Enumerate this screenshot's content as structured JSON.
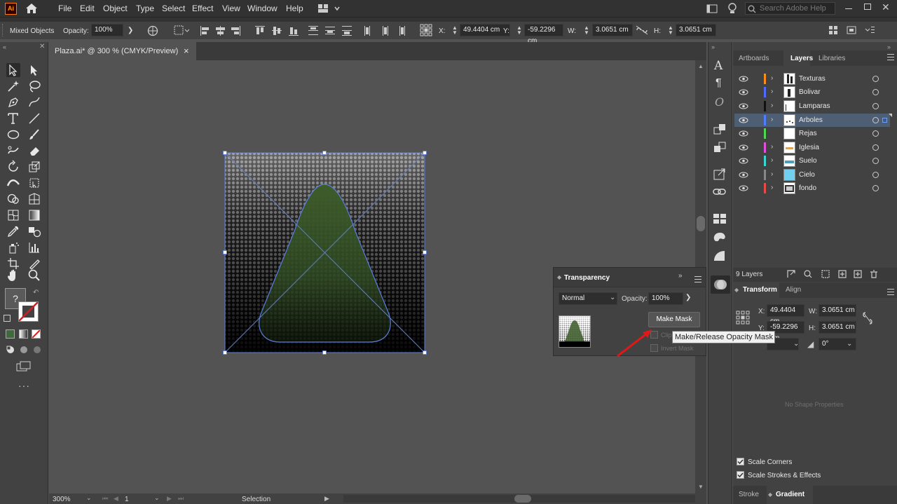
{
  "app": {
    "logo": "Ai"
  },
  "menu": [
    "File",
    "Edit",
    "Object",
    "Type",
    "Select",
    "Effect",
    "View",
    "Window",
    "Help"
  ],
  "search": {
    "placeholder": "Search Adobe Help"
  },
  "control": {
    "selection_label": "Mixed Objects",
    "opacity_label": "Opacity:",
    "opacity_value": "100%",
    "x_label": "X:",
    "x_value": "49.4404 cm",
    "y_label": "Y:",
    "y_value": "-59.2296 cm",
    "w_label": "W:",
    "w_value": "3.0651 cm",
    "h_label": "H:",
    "h_value": "3.0651 cm"
  },
  "document": {
    "tab_title": "Plaza.ai* @ 300 % (CMYK/Preview)",
    "close": "×"
  },
  "status": {
    "zoom": "300%",
    "artboard": "1",
    "tool": "Selection"
  },
  "panels": {
    "tabs": [
      "Artboards",
      "Layers",
      "Libraries"
    ],
    "layers": [
      {
        "name": "Texturas",
        "color": "#ff8c1a"
      },
      {
        "name": "Bolivar",
        "color": "#4f6cff"
      },
      {
        "name": "Lamparas",
        "color": "#111111"
      },
      {
        "name": "Arboles",
        "color": "#4f7fff",
        "selected": true
      },
      {
        "name": "Rejas",
        "color": "#4fd94f"
      },
      {
        "name": "Iglesia",
        "color": "#e44fe0"
      },
      {
        "name": "Suelo",
        "color": "#3fd4d4"
      },
      {
        "name": "Cielo",
        "color": "#888888"
      },
      {
        "name": "fondo",
        "color": "#e84a4a"
      }
    ],
    "layers_count": "9 Layers",
    "transform_tabs": [
      "Transform",
      "Align"
    ],
    "transform": {
      "x_label": "X:",
      "x_value": "49.4404 cm",
      "w_label": "W:",
      "w_value": "3.0651 cm",
      "y_label": "Y:",
      "y_value": "-59.2296 cm",
      "h_label": "H:",
      "h_value": "3.0651 cm",
      "angle_value": "0°",
      "no_shape": "No Shape Properties"
    },
    "scale_corners": "Scale Corners",
    "scale_strokes": "Scale Strokes & Effects",
    "bottom_tabs": [
      "Stroke",
      "Gradient"
    ]
  },
  "transparency": {
    "title": "Transparency",
    "blend_mode": "Normal",
    "opacity_label": "Opacity:",
    "opacity_value": "100%",
    "make_mask": "Make Mask",
    "clip_label": "Clip",
    "invert_label": "Invert Mask",
    "tooltip": "Make/Release Opacity Mask"
  },
  "colors": {
    "accent_selection": "#4f78d9",
    "shape_fill": "#3d5c2a",
    "annotation_arrow": "#e01818"
  }
}
